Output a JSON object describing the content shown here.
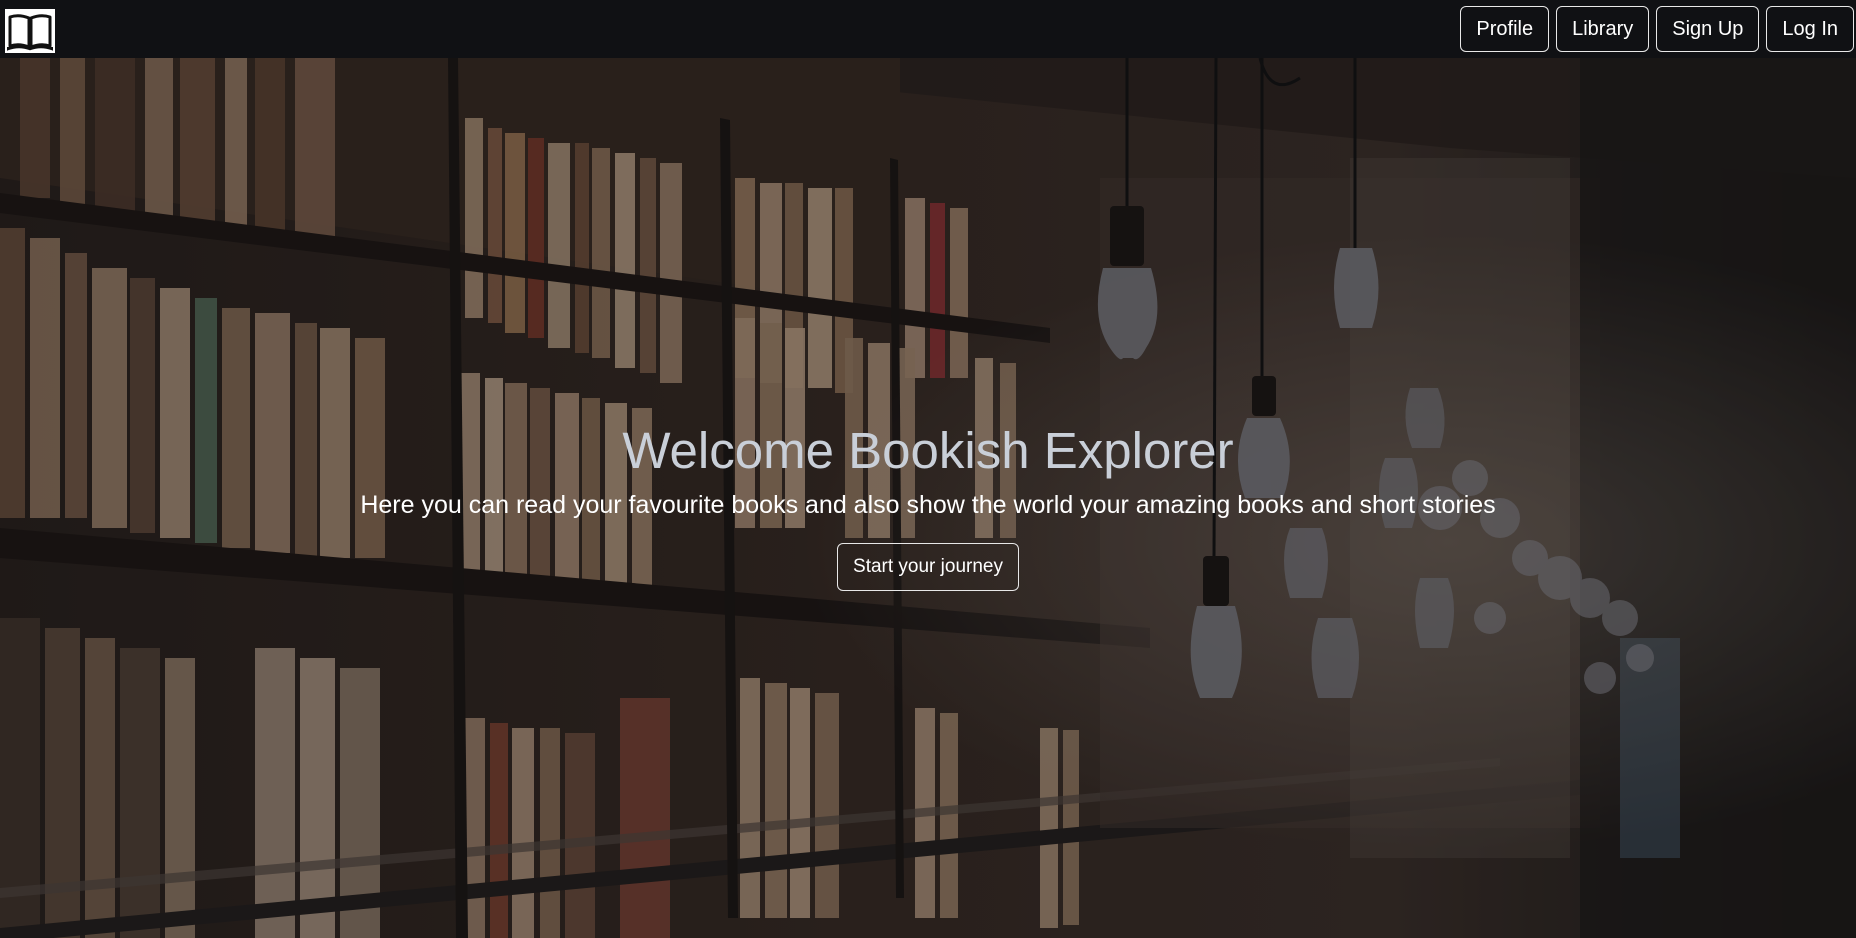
{
  "nav": {
    "logo_icon": "open-book-icon",
    "buttons": [
      {
        "label": "Profile"
      },
      {
        "label": "Library"
      },
      {
        "label": "Sign Up"
      },
      {
        "label": "Log In"
      }
    ]
  },
  "hero": {
    "title": "Welcome Bookish Explorer",
    "subtitle": "Here you can read your favourite books and also show the world your amazing books and short stories",
    "cta_label": "Start your journey",
    "background_image": "library-bookshelves-with-hanging-light-bulbs"
  },
  "colors": {
    "navbar_bg": "#101114",
    "title_color": "#c9cfd8",
    "text_color": "#ffffff",
    "button_border": "#e8e8e8"
  }
}
